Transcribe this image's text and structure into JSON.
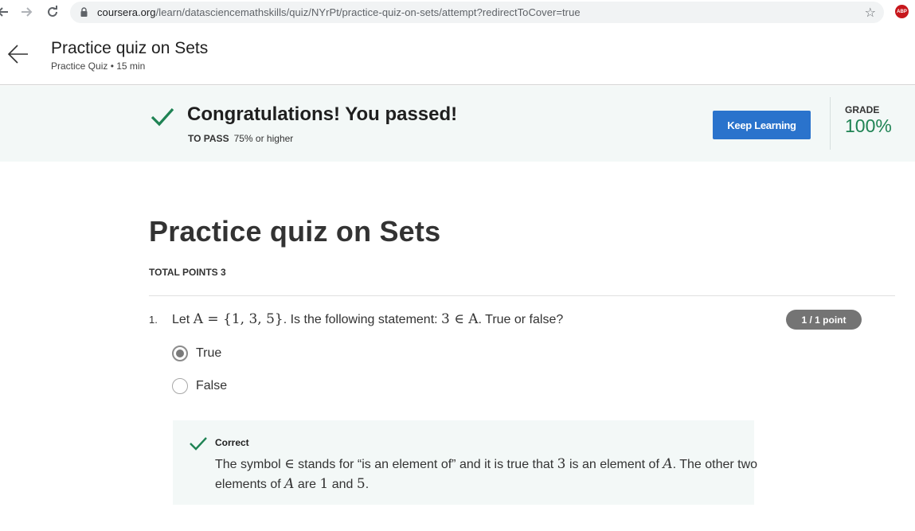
{
  "browser": {
    "url_domain": "coursera.org",
    "url_path": "/learn/datasciencemathskills/quiz/NYrPt/practice-quiz-on-sets/attempt?redirectToCover=true",
    "extension_badge": "ABP"
  },
  "header": {
    "title": "Practice quiz on Sets",
    "subtitle": "Practice Quiz • 15 min"
  },
  "banner": {
    "title": "Congratulations! You passed!",
    "to_pass_label": "TO PASS",
    "to_pass_value": "75% or higher",
    "keep_learning_label": "Keep Learning",
    "grade_label": "GRADE",
    "grade_value": "100%",
    "accent_color": "#1f8354",
    "button_color": "#2a73cc"
  },
  "quiz": {
    "title": "Practice quiz on Sets",
    "total_points": "TOTAL POINTS 3",
    "questions": [
      {
        "number": "1.",
        "text_prefix": "Let ",
        "math_set": "A = {1, 3, 5}",
        "text_middle": ". Is the following statement: ",
        "math_statement": "3 ∈ A",
        "text_suffix": ". True or false?",
        "points": "1 / 1 point",
        "options": [
          {
            "label": "True",
            "selected": true
          },
          {
            "label": "False",
            "selected": false
          }
        ],
        "feedback": {
          "label": "Correct",
          "line1_a": "The symbol ",
          "line1_sym": "∈",
          "line1_b": " stands for “is an element of” and it is true that ",
          "line1_num": "3",
          "line1_c": " is an element of ",
          "line1_var": "A",
          "line1_d": ". The other two",
          "line2_a": "elements of ",
          "line2_var": "A",
          "line2_b": " are ",
          "line2_n1": "1",
          "line2_c": " and ",
          "line2_n2": "5",
          "line2_d": "."
        }
      }
    ]
  }
}
